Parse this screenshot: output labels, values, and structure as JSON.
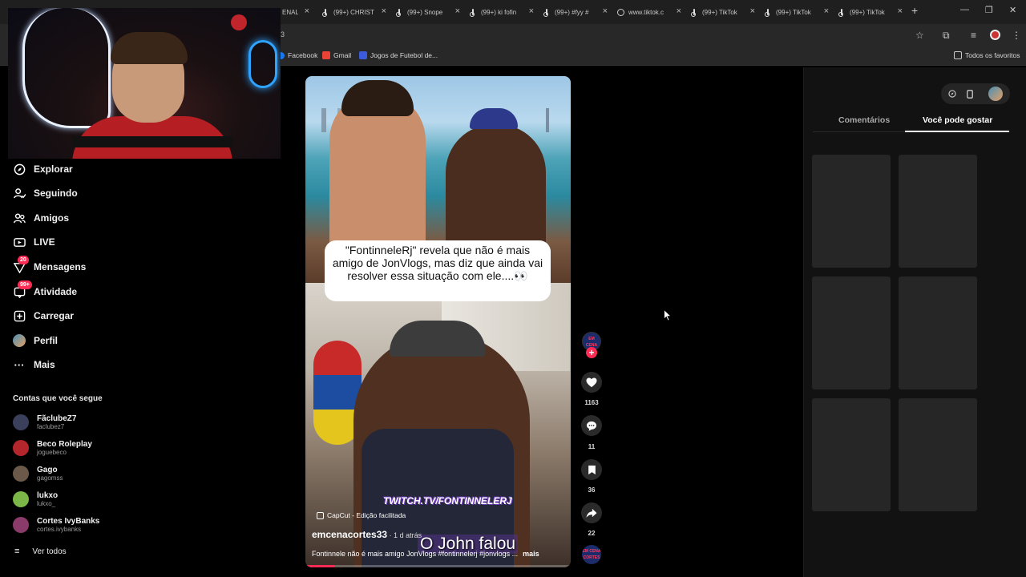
{
  "browser": {
    "tabs": [
      {
        "label": "ENALT",
        "icon": "none"
      },
      {
        "label": "(99+) CHRIST",
        "icon": "tiktok"
      },
      {
        "label": "(99+) Snope",
        "icon": "tiktok"
      },
      {
        "label": "(99+) ki fofin",
        "icon": "tiktok"
      },
      {
        "label": "(99+) #fyy #",
        "icon": "tiktok"
      },
      {
        "label": "www.tiktok.c",
        "icon": "globe"
      },
      {
        "label": "(99+) TikTok",
        "icon": "tiktok"
      },
      {
        "label": "(99+) TikTok",
        "icon": "tiktok"
      },
      {
        "label": "(99+) TikTok",
        "icon": "tiktok"
      }
    ],
    "address_fragment": "3",
    "bookmarks": [
      {
        "label": "Facebook",
        "color": "#1877f2"
      },
      {
        "label": "Gmail",
        "color": "#ea4335"
      },
      {
        "label": "Jogos de Futebol de...",
        "color": "#3b5bdb"
      }
    ],
    "all_bookmarks": "Todos os favoritos"
  },
  "sidebar": {
    "items": [
      {
        "label": "Explorar",
        "icon": "compass-icon",
        "badge": ""
      },
      {
        "label": "Seguindo",
        "icon": "user-follow-icon",
        "badge": ""
      },
      {
        "label": "Amigos",
        "icon": "friends-icon",
        "badge": ""
      },
      {
        "label": "LIVE",
        "icon": "live-icon",
        "badge": ""
      },
      {
        "label": "Mensagens",
        "icon": "send-icon",
        "badge": "20"
      },
      {
        "label": "Atividade",
        "icon": "inbox-icon",
        "badge": "99+"
      },
      {
        "label": "Carregar",
        "icon": "upload-plus-icon",
        "badge": ""
      },
      {
        "label": "Perfil",
        "icon": "avatar",
        "badge": ""
      },
      {
        "label": "Mais",
        "icon": "more-dots-icon",
        "badge": ""
      }
    ],
    "following_title": "Contas que você segue",
    "accounts": [
      {
        "name": "FãclubeZ7",
        "handle": "faclubez7",
        "color": "#3a3f5c"
      },
      {
        "name": "Beco Roleplay",
        "handle": "joguebeco",
        "color": "#b3262c"
      },
      {
        "name": "Gago",
        "handle": "gagomss",
        "color": "#6b5a4a"
      },
      {
        "name": "lukxo",
        "handle": "lukxo_",
        "color": "#7ab648"
      },
      {
        "name": "Cortes IvyBanks",
        "handle": "cortes.ivybanks",
        "color": "#8a3b6a"
      }
    ],
    "see_all": "Ver todos"
  },
  "video": {
    "caption_bubble": "\"FontinneleRj\" revela que não é mais amigo de JonVlogs, mas diz que ainda vai resolver essa situação com ele....👀",
    "overlay_twitch": "TWITCH.TV/FONTINNELERJ",
    "capcut": "CapCut - Edição facilitada",
    "author": "emcenacortes33",
    "time": " · 1 d atrás",
    "subtitle": "O John falou",
    "description": "Fontinnele não é mais amigo JonVlogs #fontinnelerj #jonvlogs ...",
    "more": "mais",
    "progress": 0.11
  },
  "actions": {
    "creator_badge": "EM CENA CORTES",
    "likes": "1163",
    "comments": "11",
    "saves": "36",
    "shares": "22"
  },
  "right_panel": {
    "tab_comments": "Comentários",
    "tab_suggested": "Você pode gostar",
    "active_tab": "Você pode gostar"
  }
}
